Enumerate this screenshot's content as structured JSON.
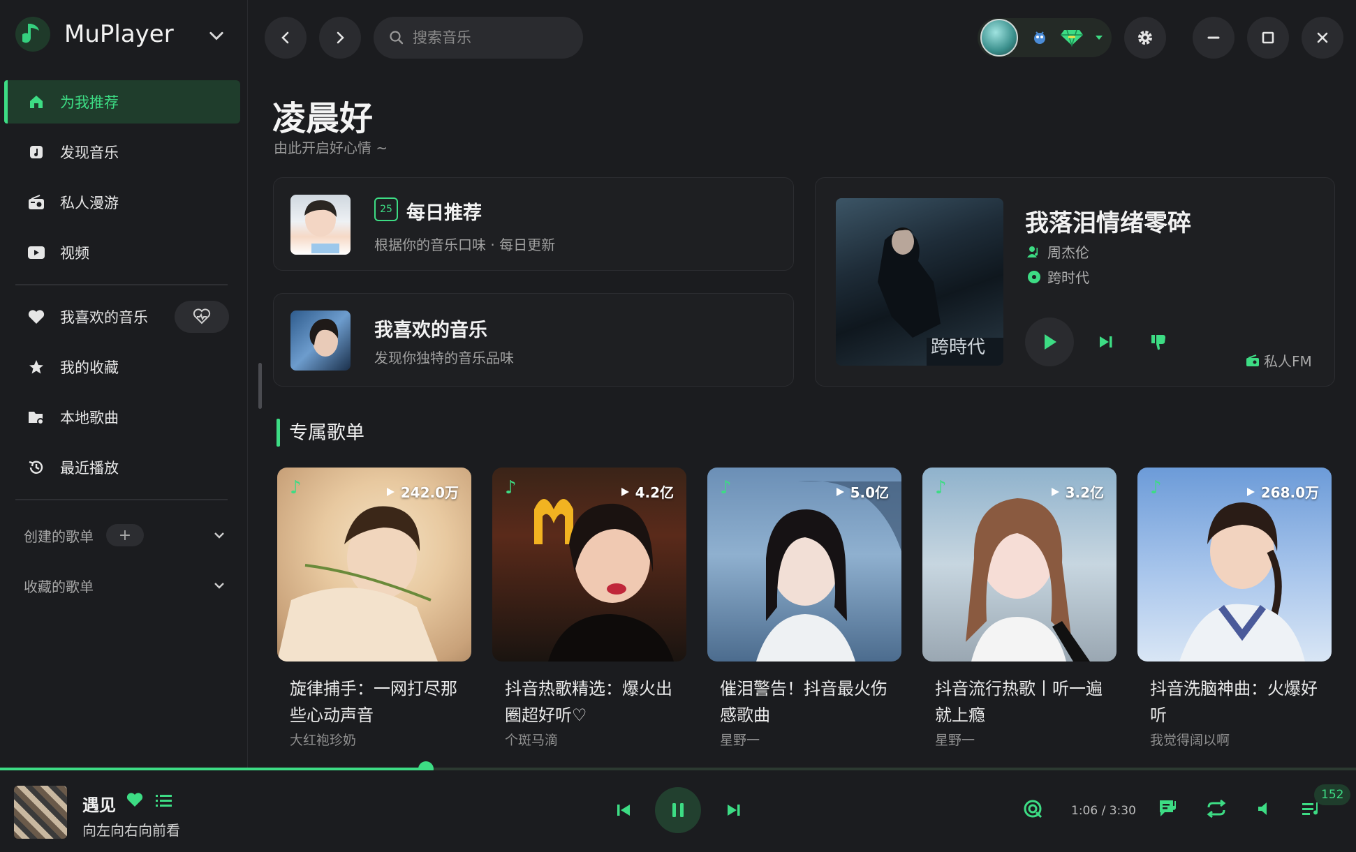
{
  "app": {
    "name": "MuPlayer"
  },
  "sidebar": {
    "items": [
      {
        "label": "为我推荐",
        "icon": "home-icon",
        "active": true
      },
      {
        "label": "发现音乐",
        "icon": "music-note-icon"
      },
      {
        "label": "私人漫游",
        "icon": "radio-icon"
      },
      {
        "label": "视频",
        "icon": "video-icon"
      }
    ],
    "library": [
      {
        "label": "我喜欢的音乐",
        "icon": "heart-icon"
      },
      {
        "label": "我的收藏",
        "icon": "star-icon"
      },
      {
        "label": "本地歌曲",
        "icon": "local-music-icon"
      },
      {
        "label": "最近播放",
        "icon": "history-icon"
      }
    ],
    "groups": [
      {
        "label": "创建的歌单",
        "add": "+"
      },
      {
        "label": "收藏的歌单"
      }
    ]
  },
  "topbar": {
    "search_placeholder": "搜索音乐"
  },
  "greeting": {
    "title": "凌晨好",
    "subtitle": "由此开启好心情 ~"
  },
  "daily": {
    "title": "每日推荐",
    "subtitle": "根据你的音乐口味 · 每日更新",
    "calendar_day": "25"
  },
  "favorite": {
    "title": "我喜欢的音乐",
    "subtitle": "发现你独特的音乐品味"
  },
  "fm": {
    "song": "我落泪情绪零碎",
    "artist": "周杰伦",
    "album": "跨时代",
    "label": "私人FM"
  },
  "section": {
    "title": "专属歌单"
  },
  "playlists": [
    {
      "title": "旋律捕手：一网打尽那些心动声音",
      "author": "大红袍珍奶",
      "count": "242.0万"
    },
    {
      "title": "抖音热歌精选：爆火出圈超好听♡",
      "author": "个斑马滴",
      "count": "4.2亿"
    },
    {
      "title": "催泪警告！抖音最火伤感歌曲",
      "author": "星野一",
      "count": "5.0亿"
    },
    {
      "title": "抖音流行热歌丨听一遍就上瘾",
      "author": "星野一",
      "count": "3.2亿"
    },
    {
      "title": "抖音洗脑神曲：火爆好听",
      "author": "我觉得阔以啊",
      "count": "268.0万"
    }
  ],
  "player": {
    "song": "遇见",
    "artist": "向左向右向前看",
    "time": "1:06 / 3:30",
    "progress": 0.314,
    "queue_count": "152"
  },
  "colors": {
    "accent": "#3ddc84",
    "background": "#1b1c1f",
    "card": "#1e1f22"
  }
}
